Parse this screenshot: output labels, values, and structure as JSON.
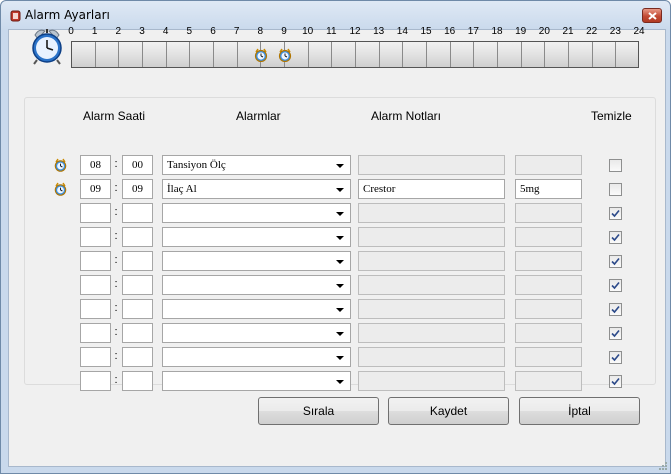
{
  "window": {
    "title": "Alarm Ayarları"
  },
  "timeline": {
    "hours": [
      "0",
      "1",
      "2",
      "3",
      "4",
      "5",
      "6",
      "7",
      "8",
      "9",
      "10",
      "11",
      "12",
      "13",
      "14",
      "15",
      "16",
      "17",
      "18",
      "19",
      "20",
      "21",
      "22",
      "23",
      "24"
    ],
    "alarm_hours": [
      8,
      9
    ]
  },
  "table": {
    "headers": {
      "alarm_time": "Alarm Saati",
      "alarms": "Alarmlar",
      "notes": "Alarm Notları",
      "clear": "Temizle"
    },
    "rows": [
      {
        "hour": "08",
        "minute": "00",
        "alarm": "Tansiyon Ölç",
        "note": "",
        "dose": "",
        "has_icon": true,
        "checked": false,
        "note_enabled": false
      },
      {
        "hour": "09",
        "minute": "09",
        "alarm": "İlaç Al",
        "note": "Crestor",
        "dose": "5mg",
        "has_icon": true,
        "checked": false,
        "note_enabled": true
      },
      {
        "hour": "",
        "minute": "",
        "alarm": "",
        "note": "",
        "dose": "",
        "has_icon": false,
        "checked": true,
        "note_enabled": false
      },
      {
        "hour": "",
        "minute": "",
        "alarm": "",
        "note": "",
        "dose": "",
        "has_icon": false,
        "checked": true,
        "note_enabled": false
      },
      {
        "hour": "",
        "minute": "",
        "alarm": "",
        "note": "",
        "dose": "",
        "has_icon": false,
        "checked": true,
        "note_enabled": false
      },
      {
        "hour": "",
        "minute": "",
        "alarm": "",
        "note": "",
        "dose": "",
        "has_icon": false,
        "checked": true,
        "note_enabled": false
      },
      {
        "hour": "",
        "minute": "",
        "alarm": "",
        "note": "",
        "dose": "",
        "has_icon": false,
        "checked": true,
        "note_enabled": false
      },
      {
        "hour": "",
        "minute": "",
        "alarm": "",
        "note": "",
        "dose": "",
        "has_icon": false,
        "checked": true,
        "note_enabled": false
      },
      {
        "hour": "",
        "minute": "",
        "alarm": "",
        "note": "",
        "dose": "",
        "has_icon": false,
        "checked": true,
        "note_enabled": false
      },
      {
        "hour": "",
        "minute": "",
        "alarm": "",
        "note": "",
        "dose": "",
        "has_icon": false,
        "checked": true,
        "note_enabled": false
      }
    ]
  },
  "buttons": {
    "sort": "Sırala",
    "save": "Kaydet",
    "cancel": "İptal"
  },
  "icons": {
    "app": "alarm-app-icon",
    "clock": "alarm-clock-icon",
    "close": "close-icon",
    "row": "small-alarm-clock-icon"
  },
  "colors": {
    "close_button": "#c24a34",
    "title_gradient_top": "#dfe9f5"
  }
}
